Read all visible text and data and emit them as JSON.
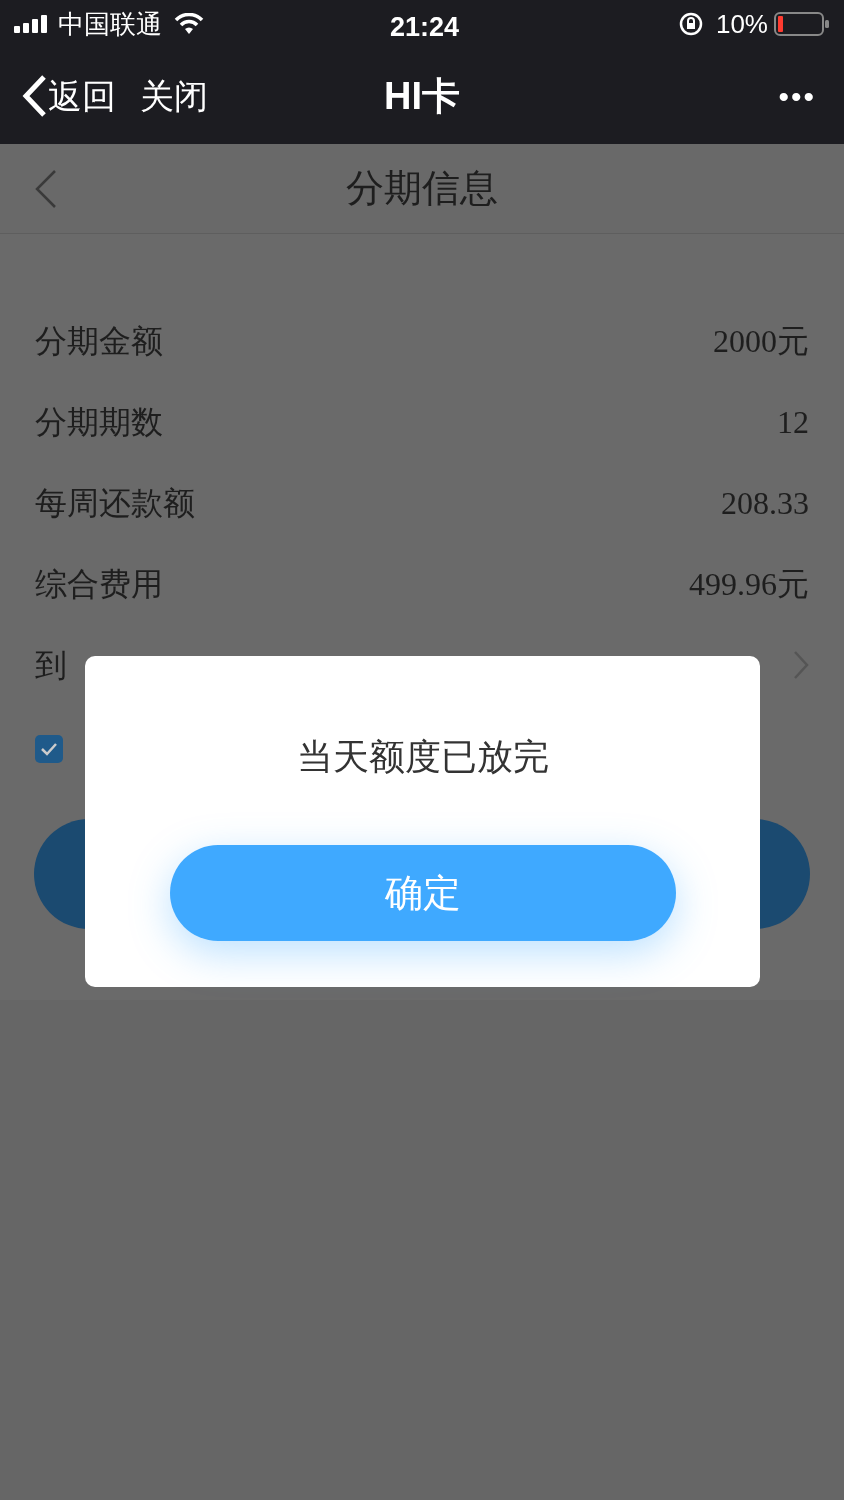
{
  "status_bar": {
    "carrier": "中国联通",
    "time": "21:24",
    "battery": "10%"
  },
  "nav_bar": {
    "back": "返回",
    "close": "关闭",
    "title": "HI卡",
    "more": "•••"
  },
  "header": {
    "title": "分期信息"
  },
  "rows": [
    {
      "label": "分期金额",
      "value": "2000元"
    },
    {
      "label": "分期期数",
      "value": "12"
    },
    {
      "label": "每周还款额",
      "value": "208.33"
    },
    {
      "label": "综合费用",
      "value": "499.96元"
    },
    {
      "label": "到",
      "value": ""
    }
  ],
  "agreement": {
    "checked": true
  },
  "dialog": {
    "message": "当天额度已放完",
    "button": "确定"
  }
}
